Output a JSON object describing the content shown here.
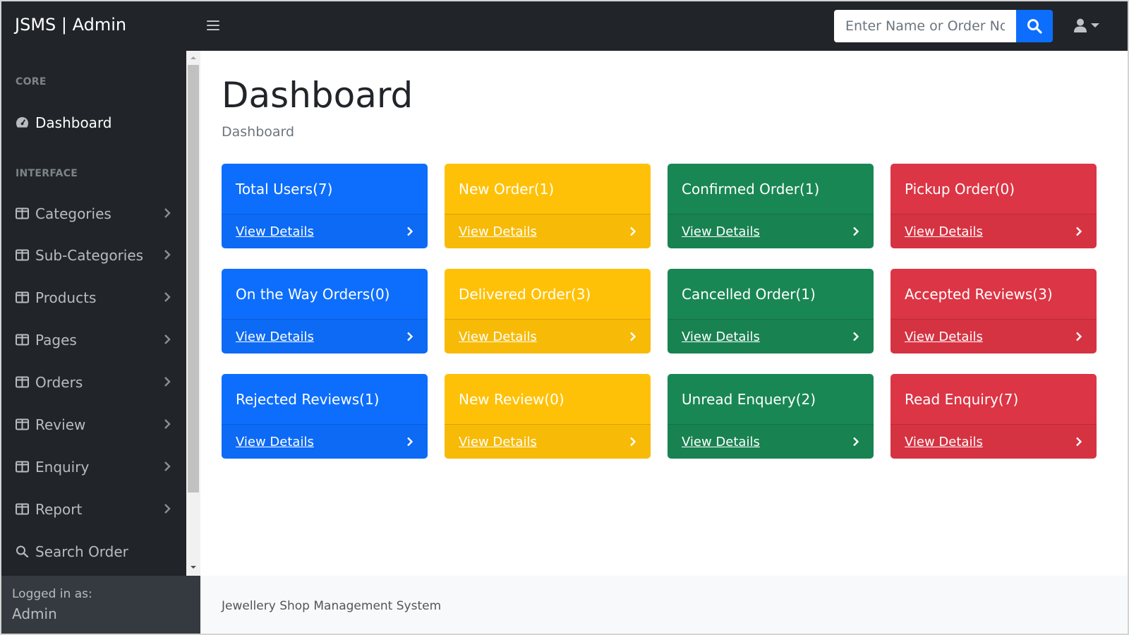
{
  "navbar": {
    "brand": "JSMS | Admin",
    "search_placeholder": "Enter Name or Order No."
  },
  "sidebar": {
    "heading_core": "CORE",
    "heading_interface": "INTERFACE",
    "items": [
      {
        "label": "Dashboard",
        "icon": "tachometer-icon",
        "has_chevron": false
      },
      {
        "label": "Categories",
        "icon": "columns-icon",
        "has_chevron": true
      },
      {
        "label": "Sub-Categories",
        "icon": "columns-icon",
        "has_chevron": true
      },
      {
        "label": "Products",
        "icon": "columns-icon",
        "has_chevron": true
      },
      {
        "label": "Pages",
        "icon": "columns-icon",
        "has_chevron": true
      },
      {
        "label": "Orders",
        "icon": "columns-icon",
        "has_chevron": true
      },
      {
        "label": "Review",
        "icon": "columns-icon",
        "has_chevron": true
      },
      {
        "label": "Enquiry",
        "icon": "columns-icon",
        "has_chevron": true
      },
      {
        "label": "Report",
        "icon": "columns-icon",
        "has_chevron": true
      },
      {
        "label": "Search Order",
        "icon": "search-icon",
        "has_chevron": false
      }
    ],
    "footer": {
      "logged_in_label": "Logged in as:",
      "user": "Admin"
    }
  },
  "main": {
    "title": "Dashboard",
    "breadcrumb": "Dashboard",
    "cards": [
      {
        "title": "Total Users(7)",
        "link": "View Details",
        "color": "#0d6efd"
      },
      {
        "title": "New Order(1)",
        "link": "View Details",
        "color": "#ffc107"
      },
      {
        "title": "Confirmed Order(1)",
        "link": "View Details",
        "color": "#198754"
      },
      {
        "title": "Pickup Order(0)",
        "link": "View Details",
        "color": "#dc3545"
      },
      {
        "title": "On the Way Orders(0)",
        "link": "View Details",
        "color": "#0d6efd"
      },
      {
        "title": "Delivered Order(3)",
        "link": "View Details",
        "color": "#ffc107"
      },
      {
        "title": "Cancelled Order(1)",
        "link": "View Details",
        "color": "#198754"
      },
      {
        "title": "Accepted Reviews(3)",
        "link": "View Details",
        "color": "#dc3545"
      },
      {
        "title": "Rejected Reviews(1)",
        "link": "View Details",
        "color": "#0d6efd"
      },
      {
        "title": "New Review(0)",
        "link": "View Details",
        "color": "#ffc107"
      },
      {
        "title": "Unread Enquery(2)",
        "link": "View Details",
        "color": "#198754"
      },
      {
        "title": "Read Enquiry(7)",
        "link": "View Details",
        "color": "#dc3545"
      }
    ]
  },
  "footer": {
    "text": "Jewellery Shop Management System"
  }
}
